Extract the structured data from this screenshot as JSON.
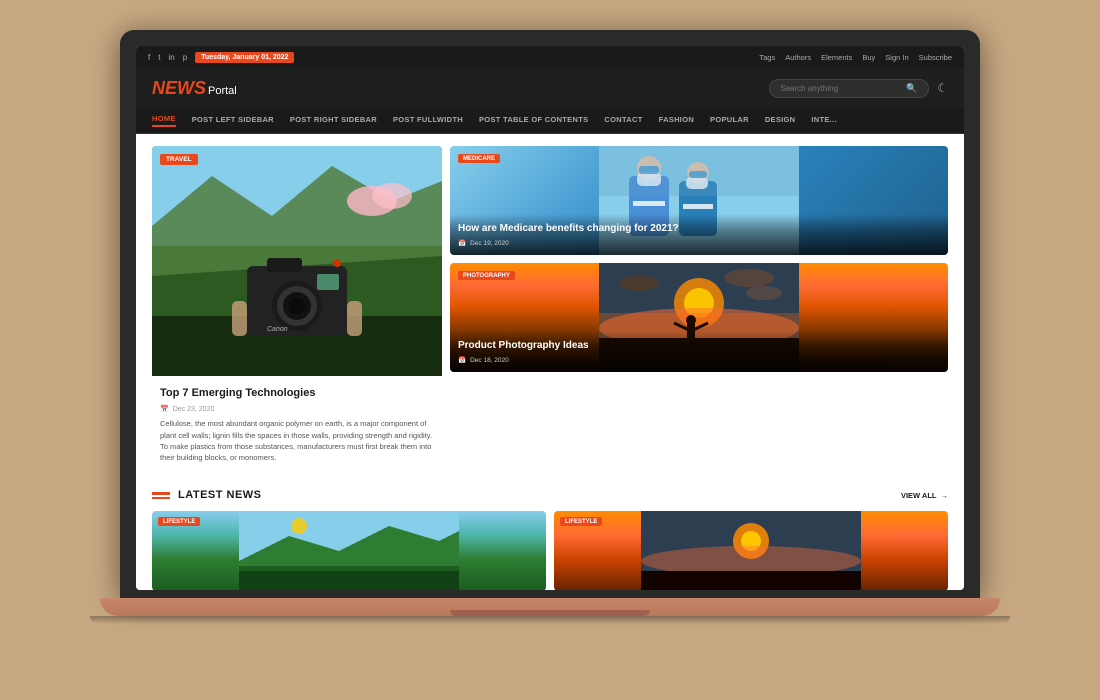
{
  "laptop": {
    "screen_label": "laptop-screen"
  },
  "topbar": {
    "date": "Tuesday, January 01, 2022",
    "social_icons": [
      "f",
      "t",
      "in",
      "p"
    ],
    "links": [
      "Tags",
      "Authors",
      "Elements",
      "Buy",
      "Sign In",
      "Subscribe"
    ]
  },
  "header": {
    "logo_news": "NEWS",
    "logo_portal": "Portal",
    "search_placeholder": "Search anything",
    "dark_mode_icon": "☾"
  },
  "nav": {
    "items": [
      {
        "label": "HOME",
        "active": true
      },
      {
        "label": "POST LEFT SIDEBAR",
        "active": false
      },
      {
        "label": "POST RIGHT SIDEBAR",
        "active": false
      },
      {
        "label": "POST FULLWIDTH",
        "active": false
      },
      {
        "label": "POST TABLE OF CONTENTS",
        "active": false
      },
      {
        "label": "CONTACT",
        "active": false
      },
      {
        "label": "FASHION",
        "active": false
      },
      {
        "label": "POPULAR",
        "active": false
      },
      {
        "label": "DESIGN",
        "active": false
      },
      {
        "label": "INTE...",
        "active": false
      }
    ]
  },
  "featured": {
    "main_article": {
      "tag": "Travel",
      "title": "Top 7 Emerging Technologies",
      "date": "Dec 23, 2020",
      "excerpt": "Cellulose, the most abundant organic polymer on earth, is a major component of plant cell walls; lignin fills the spaces in those walls, providing strength and rigidity. To make plastics from those substances, manufacturers must first break them into their building blocks, or monomers."
    },
    "side_articles": [
      {
        "tag": "Medicare",
        "title": "How are Medicare benefits changing for 2021?",
        "date": "Dec 19, 2020",
        "img_type": "medicare"
      },
      {
        "tag": "Photography",
        "title": "Product Photography Ideas",
        "date": "Dec 18, 2020",
        "img_type": "photography"
      }
    ]
  },
  "latest_news": {
    "section_label": "LATEST NEWS",
    "view_all": "VIEW ALL",
    "cards": [
      {
        "tag": "Lifestyle",
        "img_type": "landscape"
      },
      {
        "tag": "Lifestyle",
        "img_type": "sunset"
      }
    ]
  },
  "icons": {
    "search": "🔍",
    "calendar": "📅",
    "arrow_right": "→"
  }
}
